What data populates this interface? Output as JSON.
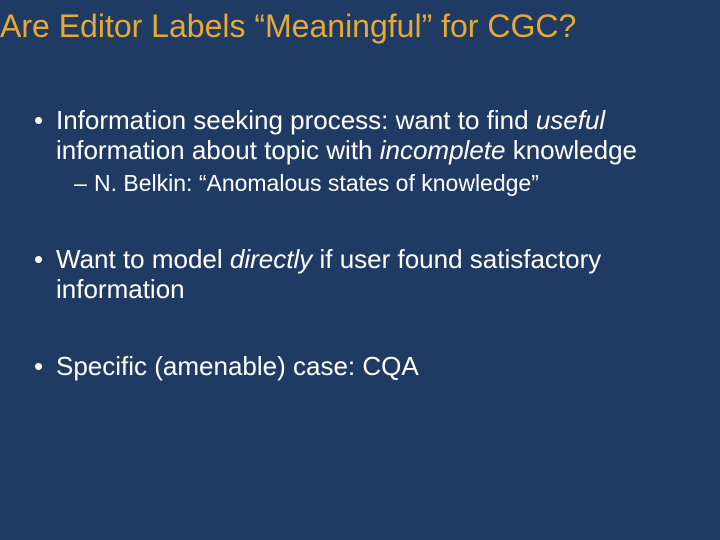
{
  "title": "Are Editor Labels “Meaningful” for CGC?",
  "b1_a": "Information seeking process: want to find ",
  "b1_b": "useful",
  "b1_c": " information about topic with ",
  "b1_d": "incomplete",
  "b1_e": " knowledge",
  "s1": "N. Belkin: “Anomalous states of knowledge”",
  "b2_a": "Want to model ",
  "b2_b": "directly",
  "b2_c": " if user found satisfactory information",
  "b3": "Specific (amenable) case: CQA"
}
